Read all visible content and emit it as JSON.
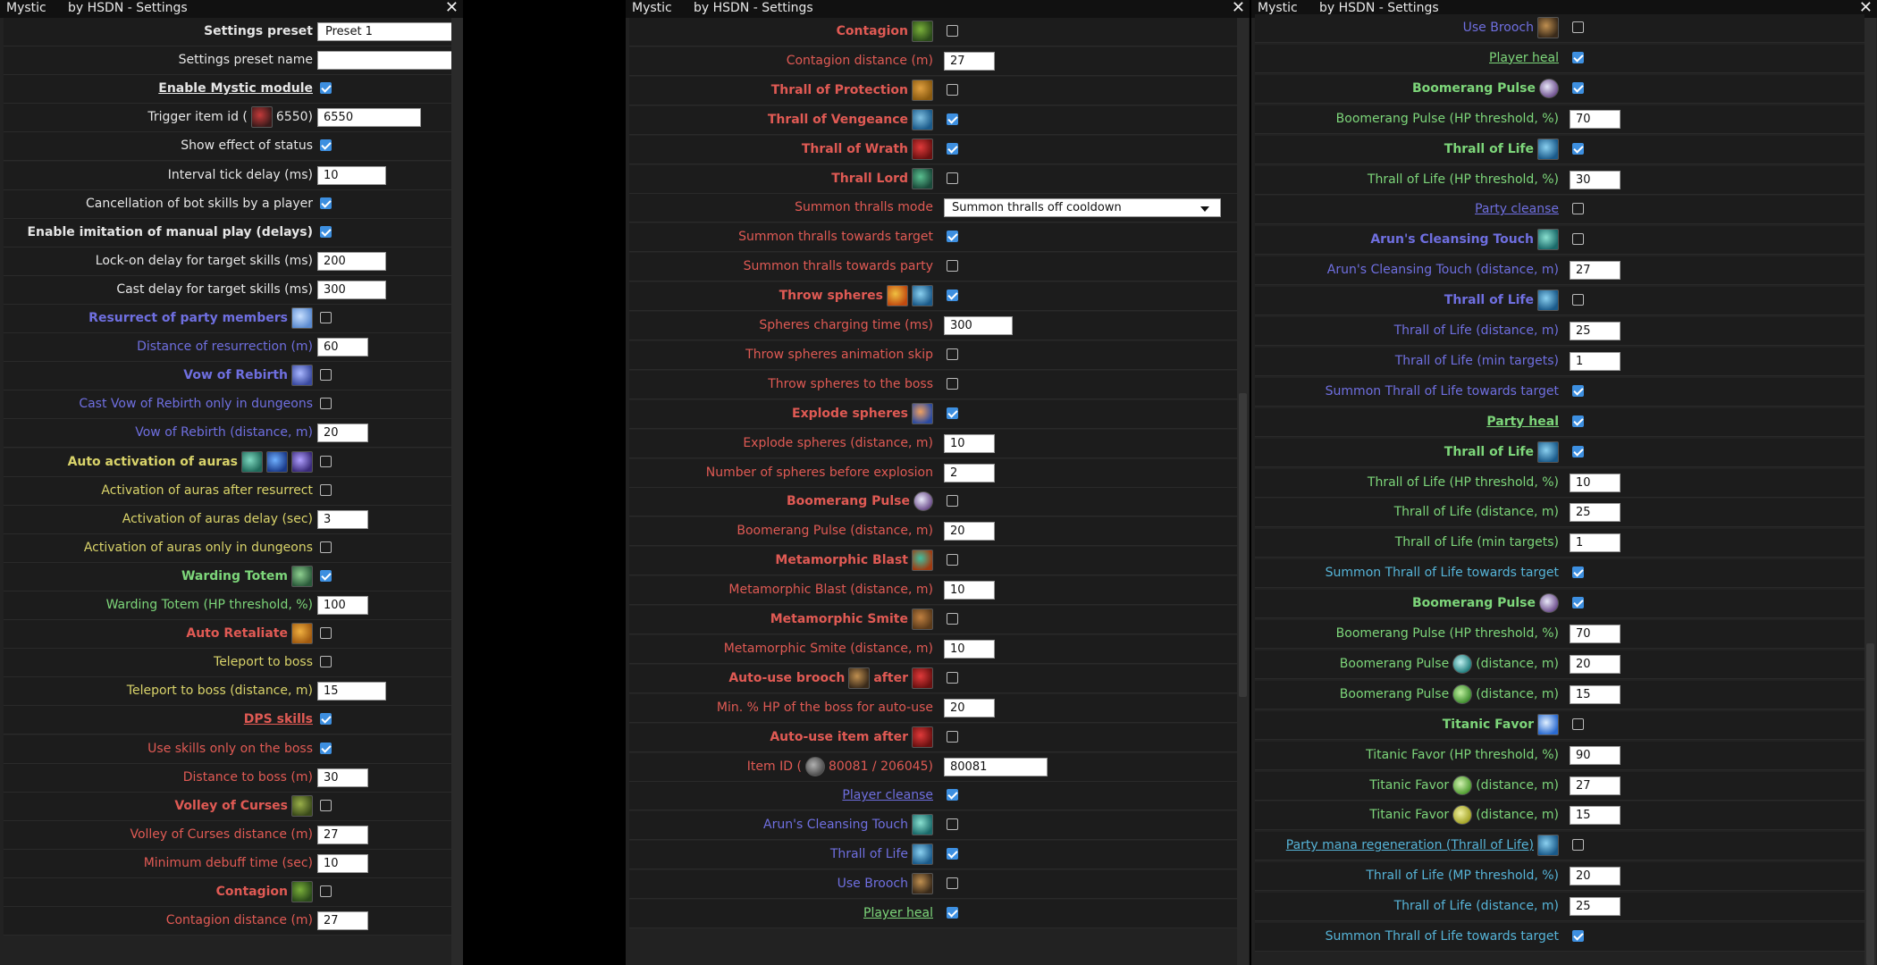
{
  "windows": [
    {
      "title": "Mystic",
      "subtitle": "by HSDN - Settings",
      "close": "✕"
    },
    {
      "title": "Mystic",
      "subtitle": "by HSDN - Settings",
      "close": "✕"
    },
    {
      "title": "Mystic",
      "subtitle": "by HSDN - Settings",
      "close": "✕"
    }
  ],
  "colors": {
    "red": "#e05a54",
    "blue": "#6f6fe0",
    "yellow": "#d9d36a",
    "green": "#7dd67a",
    "cyan": "#56b4d8",
    "check": "#3d8fe0"
  },
  "col1": [
    {
      "label": "Settings preset",
      "cls": "c-white b",
      "ctl": "select",
      "value": "Preset 1"
    },
    {
      "label": "Settings preset name",
      "cls": "c-white",
      "ctl": "input",
      "value": "",
      "w": "wide"
    },
    {
      "label": "Enable Mystic module",
      "cls": "c-white b u",
      "ctl": "check",
      "on": true
    },
    {
      "label": "Trigger item id (",
      "cls": "c-white",
      "ctl": "input",
      "value": "6550",
      "w": "mid",
      "icons": [
        "brooch-item-icon"
      ],
      "after": "6550)"
    },
    {
      "label": "Show effect of status",
      "cls": "c-white",
      "ctl": "check",
      "on": true
    },
    {
      "label": "Interval tick delay (ms)",
      "cls": "c-white",
      "ctl": "input",
      "value": "10",
      "w": "sm"
    },
    {
      "label": "Cancellation of bot skills by a player",
      "cls": "c-white",
      "ctl": "check",
      "on": true
    },
    {
      "label": "Enable imitation of manual play (delays)",
      "cls": "c-white b",
      "ctl": "check",
      "on": true
    },
    {
      "label": "Lock-on delay for target skills (ms)",
      "cls": "c-white",
      "ctl": "input",
      "value": "200",
      "w": "sm"
    },
    {
      "label": "Cast delay for target skills (ms)",
      "cls": "c-white",
      "ctl": "input",
      "value": "300",
      "w": "sm"
    },
    {
      "label": "Resurrect of party members",
      "cls": "c-blue b",
      "ctl": "check",
      "on": false,
      "icons": [
        "resurrect-icon"
      ]
    },
    {
      "label": "Distance of resurrection (m)",
      "cls": "c-blue",
      "ctl": "input",
      "value": "60",
      "w": "xs"
    },
    {
      "label": "Vow of Rebirth",
      "cls": "c-blue b",
      "ctl": "check",
      "on": false,
      "icons": [
        "vow-of-rebirth-icon"
      ]
    },
    {
      "label": "Cast Vow of Rebirth only in dungeons",
      "cls": "c-blue",
      "ctl": "check",
      "on": false
    },
    {
      "label": "Vow of Rebirth (distance, m)",
      "cls": "c-blue",
      "ctl": "input",
      "value": "20",
      "w": "xs"
    },
    {
      "label": "Auto activation of auras",
      "cls": "c-yellow b",
      "ctl": "check",
      "on": false,
      "icons": [
        "aura-green-icon",
        "aura-blue-icon",
        "aura-purple-icon"
      ]
    },
    {
      "label": "Activation of auras after resurrect",
      "cls": "c-yellow",
      "ctl": "check",
      "on": false
    },
    {
      "label": "Activation of auras delay (sec)",
      "cls": "c-yellow",
      "ctl": "input",
      "value": "3",
      "w": "xs"
    },
    {
      "label": "Activation of auras only in dungeons",
      "cls": "c-yellow",
      "ctl": "check",
      "on": false
    },
    {
      "label": "Warding Totem",
      "cls": "c-green b",
      "ctl": "check",
      "on": true,
      "icons": [
        "warding-totem-icon"
      ]
    },
    {
      "label": "Warding Totem (HP threshold, %)",
      "cls": "c-green",
      "ctl": "input",
      "value": "100",
      "w": "xs"
    },
    {
      "label": "Auto Retaliate",
      "cls": "c-red b",
      "ctl": "check",
      "on": false,
      "icons": [
        "auto-retaliate-icon"
      ]
    },
    {
      "label": "Teleport to boss",
      "cls": "c-yellow",
      "ctl": "check",
      "on": false
    },
    {
      "label": "Teleport to boss (distance, m)",
      "cls": "c-yellow",
      "ctl": "input",
      "value": "15",
      "w": "sm"
    },
    {
      "label": "DPS skills",
      "cls": "c-red b u",
      "ctl": "check",
      "on": true
    },
    {
      "label": "Use skills only on the boss",
      "cls": "c-red",
      "ctl": "check",
      "on": true
    },
    {
      "label": "Distance to boss (m)",
      "cls": "c-red",
      "ctl": "input",
      "value": "30",
      "w": "xs"
    },
    {
      "label": "Volley of Curses",
      "cls": "c-red b",
      "ctl": "check",
      "on": false,
      "icons": [
        "volley-of-curses-icon"
      ]
    },
    {
      "label": "Volley of Curses distance (m)",
      "cls": "c-red",
      "ctl": "input",
      "value": "27",
      "w": "xs"
    },
    {
      "label": "Minimum debuff time (sec)",
      "cls": "c-red",
      "ctl": "input",
      "value": "10",
      "w": "xs"
    },
    {
      "label": "Contagion",
      "cls": "c-red b",
      "ctl": "check",
      "on": false,
      "icons": [
        "contagion-icon"
      ]
    },
    {
      "label": "Contagion distance (m)",
      "cls": "c-red",
      "ctl": "input",
      "value": "27",
      "w": "xs"
    }
  ],
  "col2": [
    {
      "label": "Contagion",
      "cls": "c-red b",
      "ctl": "check",
      "on": false,
      "icons": [
        "contagion-icon"
      ]
    },
    {
      "label": "Contagion distance (m)",
      "cls": "c-red",
      "ctl": "input",
      "value": "27",
      "w": "xs"
    },
    {
      "label": "Thrall of Protection",
      "cls": "c-red b",
      "ctl": "check",
      "on": false,
      "icons": [
        "thrall-of-protection-icon"
      ]
    },
    {
      "label": "Thrall of Vengeance",
      "cls": "c-red b",
      "ctl": "check",
      "on": true,
      "icons": [
        "thrall-of-vengeance-icon"
      ]
    },
    {
      "label": "Thrall of Wrath",
      "cls": "c-red b",
      "ctl": "check",
      "on": true,
      "icons": [
        "thrall-of-wrath-icon"
      ]
    },
    {
      "label": "Thrall Lord",
      "cls": "c-red b",
      "ctl": "check",
      "on": false,
      "icons": [
        "thrall-lord-icon"
      ]
    },
    {
      "label": "Summon thralls mode",
      "cls": "c-red",
      "ctl": "select",
      "value": "Summon thralls off cooldown"
    },
    {
      "label": "Summon thralls towards target",
      "cls": "c-red",
      "ctl": "check",
      "on": true
    },
    {
      "label": "Summon thralls towards party",
      "cls": "c-red",
      "ctl": "check",
      "on": false
    },
    {
      "label": "Throw spheres",
      "cls": "c-red b",
      "ctl": "check",
      "on": true,
      "icons": [
        "throw-spheres-icon",
        "sphere-search-icon"
      ]
    },
    {
      "label": "Spheres charging time (ms)",
      "cls": "c-red",
      "ctl": "input",
      "value": "300",
      "w": "sm"
    },
    {
      "label": "Throw spheres animation skip",
      "cls": "c-red",
      "ctl": "check",
      "on": false
    },
    {
      "label": "Throw spheres to the boss",
      "cls": "c-red",
      "ctl": "check",
      "on": false
    },
    {
      "label": "Explode spheres",
      "cls": "c-red b",
      "ctl": "check",
      "on": true,
      "icons": [
        "explode-spheres-icon"
      ]
    },
    {
      "label": "Explode spheres (distance, m)",
      "cls": "c-red",
      "ctl": "input",
      "value": "10",
      "w": "xs"
    },
    {
      "label": "Number of spheres before explosion",
      "cls": "c-red",
      "ctl": "input",
      "value": "2",
      "w": "xs"
    },
    {
      "label": "Boomerang Pulse",
      "cls": "c-red b",
      "ctl": "check",
      "on": false,
      "icons": [
        "boomerang-pulse-icon"
      ]
    },
    {
      "label": "Boomerang Pulse (distance, m)",
      "cls": "c-red",
      "ctl": "input",
      "value": "20",
      "w": "xs"
    },
    {
      "label": "Metamorphic Blast",
      "cls": "c-red b",
      "ctl": "check",
      "on": false,
      "icons": [
        "metamorphic-blast-icon"
      ]
    },
    {
      "label": "Metamorphic Blast (distance, m)",
      "cls": "c-red",
      "ctl": "input",
      "value": "10",
      "w": "xs"
    },
    {
      "label": "Metamorphic Smite",
      "cls": "c-red b",
      "ctl": "check",
      "on": false,
      "icons": [
        "metamorphic-smite-icon"
      ]
    },
    {
      "label": "Metamorphic Smite (distance, m)",
      "cls": "c-red",
      "ctl": "input",
      "value": "10",
      "w": "xs"
    },
    {
      "label": "Auto-use brooch",
      "cls": "c-red b",
      "ctl": "check",
      "on": false,
      "icons": [
        "brooch-icon"
      ],
      "mid": "after",
      "icons2": [
        "thrall-of-wrath-icon"
      ]
    },
    {
      "label": "Min. % HP of the boss for auto-use",
      "cls": "c-red",
      "ctl": "input",
      "value": "20",
      "w": "xs"
    },
    {
      "label": "Auto-use item after",
      "cls": "c-red b",
      "ctl": "check",
      "on": false,
      "icons": [
        "thrall-of-wrath-icon"
      ]
    },
    {
      "label": "Item ID (",
      "cls": "c-red",
      "ctl": "input",
      "value": "80081",
      "w": "mid",
      "icons": [
        "item-icon"
      ],
      "after": "80081 / 206045)"
    },
    {
      "label": "Player cleanse",
      "cls": "c-blue u",
      "ctl": "check",
      "on": true
    },
    {
      "label": "Arun's Cleansing Touch",
      "cls": "c-blue",
      "ctl": "check",
      "on": false,
      "icons": [
        "aruns-cleansing-touch-icon"
      ]
    },
    {
      "label": "Thrall of Life",
      "cls": "c-blue",
      "ctl": "check",
      "on": true,
      "icons": [
        "thrall-of-life-icon"
      ]
    },
    {
      "label": "Use Brooch",
      "cls": "c-blue",
      "ctl": "check",
      "on": false,
      "icons": [
        "brooch-icon"
      ]
    },
    {
      "label": "Player heal",
      "cls": "c-green u",
      "ctl": "check",
      "on": true
    }
  ],
  "col3": [
    {
      "label": "Use Brooch",
      "cls": "c-blue",
      "ctl": "check",
      "on": false,
      "icons": [
        "brooch-icon"
      ]
    },
    {
      "label": "Player heal",
      "cls": "c-green u",
      "ctl": "check",
      "on": true
    },
    {
      "label": "Boomerang Pulse",
      "cls": "c-green b",
      "ctl": "check",
      "on": true,
      "icons": [
        "boomerang-pulse-icon"
      ]
    },
    {
      "label": "Boomerang Pulse (HP threshold, %)",
      "cls": "c-green",
      "ctl": "input",
      "value": "70",
      "w": "xs"
    },
    {
      "label": "Thrall of Life",
      "cls": "c-green b",
      "ctl": "check",
      "on": true,
      "icons": [
        "thrall-of-life-icon"
      ]
    },
    {
      "label": "Thrall of Life (HP threshold, %)",
      "cls": "c-green",
      "ctl": "input",
      "value": "30",
      "w": "xs"
    },
    {
      "label": "Party cleanse",
      "cls": "c-blue u",
      "ctl": "check",
      "on": false
    },
    {
      "label": "Arun's Cleansing Touch",
      "cls": "c-blue b",
      "ctl": "check",
      "on": false,
      "icons": [
        "aruns-cleansing-touch-icon"
      ]
    },
    {
      "label": "Arun's Cleansing Touch (distance, m)",
      "cls": "c-blue",
      "ctl": "input",
      "value": "27",
      "w": "xs"
    },
    {
      "label": "Thrall of Life",
      "cls": "c-blue b",
      "ctl": "check",
      "on": false,
      "icons": [
        "thrall-of-life-icon"
      ]
    },
    {
      "label": "Thrall of Life (distance, m)",
      "cls": "c-blue",
      "ctl": "input",
      "value": "25",
      "w": "xs"
    },
    {
      "label": "Thrall of Life (min targets)",
      "cls": "c-blue",
      "ctl": "input",
      "value": "1",
      "w": "xs"
    },
    {
      "label": "Summon Thrall of Life towards target",
      "cls": "c-blue",
      "ctl": "check",
      "on": true
    },
    {
      "label": "Party heal",
      "cls": "c-green b u",
      "ctl": "check",
      "on": true
    },
    {
      "label": "Thrall of Life",
      "cls": "c-green b",
      "ctl": "check",
      "on": true,
      "icons": [
        "thrall-of-life-icon"
      ]
    },
    {
      "label": "Thrall of Life (HP threshold, %)",
      "cls": "c-green",
      "ctl": "input",
      "value": "10",
      "w": "xs"
    },
    {
      "label": "Thrall of Life (distance, m)",
      "cls": "c-green",
      "ctl": "input",
      "value": "25",
      "w": "xs"
    },
    {
      "label": "Thrall of Life (min targets)",
      "cls": "c-green",
      "ctl": "input",
      "value": "1",
      "w": "xs"
    },
    {
      "label": "Summon Thrall of Life towards target",
      "cls": "c-cyan",
      "ctl": "check",
      "on": true
    },
    {
      "label": "Boomerang Pulse",
      "cls": "c-green b",
      "ctl": "check",
      "on": true,
      "icons": [
        "boomerang-pulse-icon"
      ]
    },
    {
      "label": "Boomerang Pulse (HP threshold, %)",
      "cls": "c-green",
      "ctl": "input",
      "value": "70",
      "w": "xs"
    },
    {
      "label": "Boomerang Pulse",
      "cls": "c-green",
      "ctl": "input",
      "value": "20",
      "w": "xs",
      "icons": [
        "pulse-teal-icon"
      ],
      "after": "(distance, m)"
    },
    {
      "label": "Boomerang Pulse",
      "cls": "c-green",
      "ctl": "input",
      "value": "15",
      "w": "xs",
      "icons": [
        "pulse-green-icon"
      ],
      "after": "(distance, m)"
    },
    {
      "label": "Titanic Favor",
      "cls": "c-green b",
      "ctl": "check",
      "on": false,
      "icons": [
        "titanic-favor-icon"
      ]
    },
    {
      "label": "Titanic Favor (HP threshold, %)",
      "cls": "c-green",
      "ctl": "input",
      "value": "90",
      "w": "xs"
    },
    {
      "label": "Titanic Favor",
      "cls": "c-green",
      "ctl": "input",
      "value": "27",
      "w": "xs",
      "icons": [
        "favor-green-icon"
      ],
      "after": "(distance, m)"
    },
    {
      "label": "Titanic Favor",
      "cls": "c-green",
      "ctl": "input",
      "value": "15",
      "w": "xs",
      "icons": [
        "favor-yellow-icon"
      ],
      "after": "(distance, m)"
    },
    {
      "label": "Party mana regeneration (Thrall of Life)",
      "cls": "c-cyan u",
      "ctl": "check",
      "on": false,
      "icons": [
        "thrall-of-life-icon"
      ]
    },
    {
      "label": "Thrall of Life (MP threshold, %)",
      "cls": "c-cyan",
      "ctl": "input",
      "value": "20",
      "w": "xs"
    },
    {
      "label": "Thrall of Life (distance, m)",
      "cls": "c-cyan",
      "ctl": "input",
      "value": "25",
      "w": "xs"
    },
    {
      "label": "Summon Thrall of Life towards target",
      "cls": "c-cyan",
      "ctl": "check",
      "on": true
    }
  ]
}
